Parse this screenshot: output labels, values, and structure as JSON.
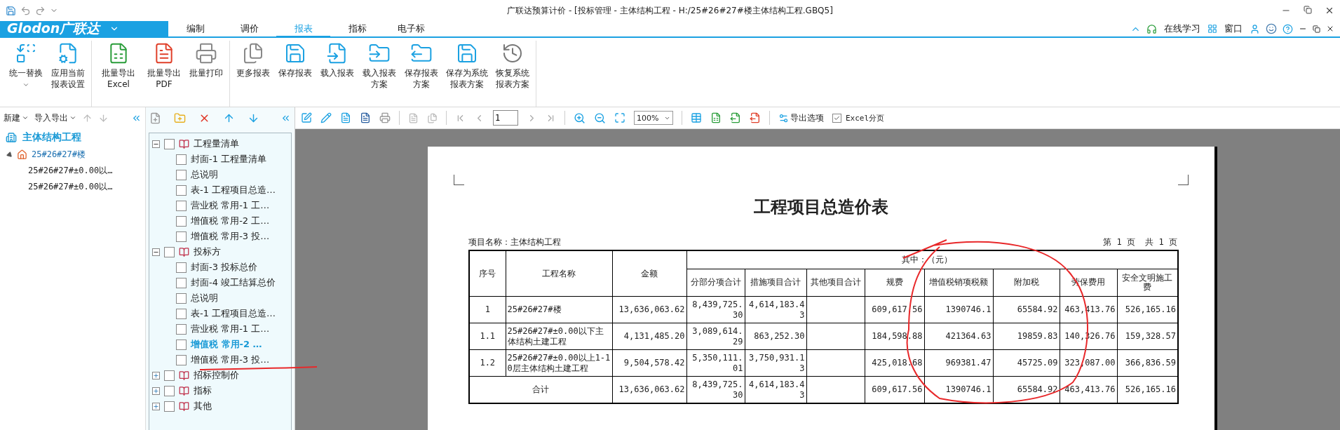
{
  "window": {
    "title": "广联达预算计价 - [投标管理 - 主体结构工程 - H:/25#26#27#楼主体结构工程.GBQ5]"
  },
  "menu": {
    "logo": "Glodon广联达",
    "tabs": [
      {
        "label": "编制",
        "selected": false
      },
      {
        "label": "调价",
        "selected": false
      },
      {
        "label": "报表",
        "selected": true
      },
      {
        "label": "指标",
        "selected": false
      },
      {
        "label": "电子标",
        "selected": false
      }
    ],
    "links": [
      "在线学习",
      "窗口"
    ]
  },
  "ribbon": {
    "groups": [
      {
        "buttons": [
          {
            "label": "统一替换",
            "dropdown": true
          },
          {
            "label": "应用当前报表设置",
            "dropdown": false
          }
        ]
      },
      {
        "buttons": [
          {
            "label": "批量导出\nExcel",
            "dropdown": false
          },
          {
            "label": "批量导出\nPDF",
            "dropdown": false
          },
          {
            "label": "批量打印",
            "dropdown": false
          }
        ]
      },
      {
        "buttons": [
          {
            "label": "更多报表",
            "dropdown": false
          },
          {
            "label": "保存报表",
            "dropdown": false
          },
          {
            "label": "载入报表",
            "dropdown": false
          },
          {
            "label": "载入报表方案",
            "dropdown": false
          },
          {
            "label": "保存报表方案",
            "dropdown": false
          },
          {
            "label": "保存为系统报表方案",
            "dropdown": false
          },
          {
            "label": "恢复系统报表方案",
            "dropdown": false
          }
        ]
      }
    ]
  },
  "project_panel": {
    "toolbar": [
      "新建",
      "导入导出"
    ],
    "root": "主体结构工程",
    "items": [
      {
        "label": "25#26#27#楼",
        "expanded": true,
        "children": [
          {
            "label": "25#26#27#±0.00以…"
          },
          {
            "label": "25#26#27#±0.00以…"
          }
        ]
      }
    ]
  },
  "report_panel": {
    "tree": [
      {
        "label": "工程量清单",
        "expanded": true,
        "checked": false,
        "children": [
          {
            "label": "封面-1 工程量清单",
            "checked": false,
            "selected": false
          },
          {
            "label": "总说明",
            "checked": false,
            "selected": false
          },
          {
            "label": "表-1 工程项目总造…",
            "checked": false,
            "selected": false
          },
          {
            "label": "营业税 常用-1 工…",
            "checked": false,
            "selected": false
          },
          {
            "label": "增值税 常用-2 工…",
            "checked": false,
            "selected": false
          },
          {
            "label": "增值税 常用-3 投…",
            "checked": false,
            "selected": false
          }
        ]
      },
      {
        "label": "投标方",
        "expanded": true,
        "checked": false,
        "children": [
          {
            "label": "封面-3 投标总价",
            "checked": false,
            "selected": false
          },
          {
            "label": "封面-4 竣工结算总价",
            "checked": false,
            "selected": false
          },
          {
            "label": "总说明",
            "checked": false,
            "selected": false
          },
          {
            "label": "表-1 工程项目总造…",
            "checked": false,
            "selected": false
          },
          {
            "label": "营业税 常用-1 工…",
            "checked": false,
            "selected": false
          },
          {
            "label": "增值税 常用-2 …",
            "checked": false,
            "selected": true
          },
          {
            "label": "增值税 常用-3 投…",
            "checked": false,
            "selected": false
          }
        ]
      },
      {
        "label": "招标控制价",
        "expanded": false,
        "checked": false
      },
      {
        "label": "指标",
        "expanded": false,
        "checked": false
      },
      {
        "label": "其他",
        "expanded": false,
        "checked": false
      }
    ]
  },
  "preview": {
    "page_input": "1",
    "zoom": "100%",
    "export_options": "导出选项",
    "excel_paging": {
      "label": "Excel分页",
      "checked": true
    },
    "report": {
      "title": "工程项目总造价表",
      "project": "项目名称：主体结构工程",
      "page_info": "第 1 页  共 1 页",
      "group_header": "其中：（元）",
      "columns": [
        "序号",
        "工程名称",
        "金额"
      ],
      "sub_columns": [
        {
          "label": "分部分项合计",
          "blank": false
        },
        {
          "label": "措施项目合计",
          "blank": false
        },
        {
          "label": "其他项目合计",
          "blank": true
        },
        {
          "label": "规费",
          "blank": false
        },
        {
          "label": "增值税销项税额",
          "blank": false
        },
        {
          "label": "附加税",
          "blank": false
        },
        {
          "label": "劳保费用",
          "blank": false
        },
        {
          "label": "安全文明施工费",
          "blank": false
        }
      ],
      "rows": [
        {
          "no": "1",
          "name": "25#26#27#楼",
          "amount": "13,636,063.62",
          "values": [
            "8,439,725.30",
            "4,614,183.43",
            "609,617.56",
            "1390746.1",
            "65584.92",
            "463,413.76",
            "526,165.16"
          ]
        },
        {
          "no": "1.1",
          "name": "25#26#27#±0.00以下主体结构土建工程",
          "amount": "4,131,485.20",
          "values": [
            "3,089,614.29",
            "863,252.30",
            "184,598.88",
            "421364.63",
            "19859.83",
            "140,326.76",
            "159,328.57"
          ]
        },
        {
          "no": "1.2",
          "name": "25#26#27#±0.00以上1-10层主体结构土建工程",
          "amount": "9,504,578.42",
          "values": [
            "5,350,111.01",
            "3,750,931.13",
            "425,018.68",
            "969381.47",
            "45725.09",
            "323,087.00",
            "366,836.59"
          ]
        }
      ],
      "total": {
        "label": "合计",
        "amount": "13,636,063.62",
        "values": [
          "8,439,725.30",
          "4,614,183.43",
          "609,617.56",
          "1390746.1",
          "65584.92",
          "463,413.76",
          "526,165.16"
        ]
      }
    }
  }
}
